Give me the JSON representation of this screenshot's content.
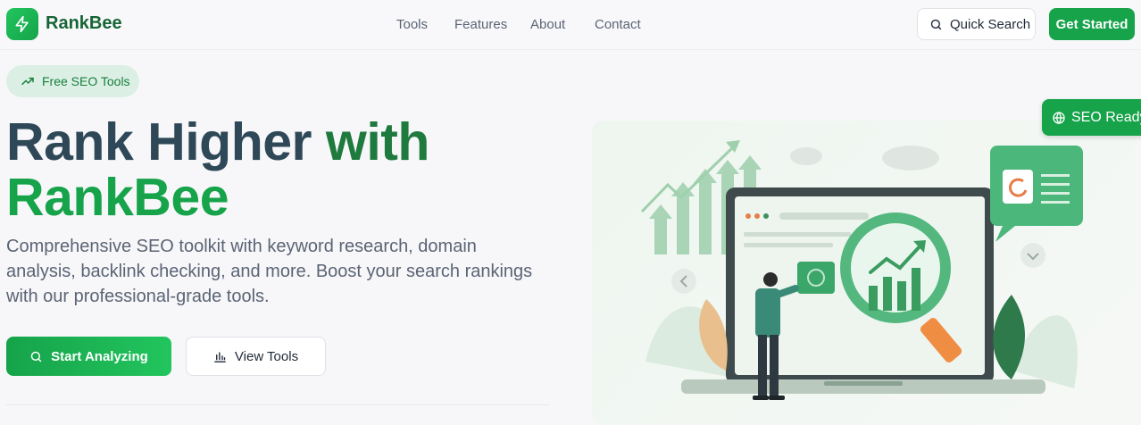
{
  "brand": {
    "name": "RankBee"
  },
  "nav": {
    "links": [
      "Tools",
      "Features",
      "About",
      "Contact"
    ],
    "quick_search_label": "Quick Search",
    "cta_label": "Get Started"
  },
  "hero": {
    "pill_label": "Free SEO Tools",
    "title_line1_a": "Rank Higher",
    "title_line1_b": " with",
    "title_line2": "RankBee",
    "description": "Comprehensive SEO toolkit with keyword research, domain analysis, backlink checking, and more. Boost your search rankings with our professional-grade tools.",
    "primary_button": "Start Analyzing",
    "secondary_button": "View Tools"
  },
  "illustration": {
    "badge_label": "SEO Ready"
  },
  "colors": {
    "accent": "#16a34a",
    "accent_light": "#dcefe4",
    "heading_dark": "#2f4858"
  }
}
